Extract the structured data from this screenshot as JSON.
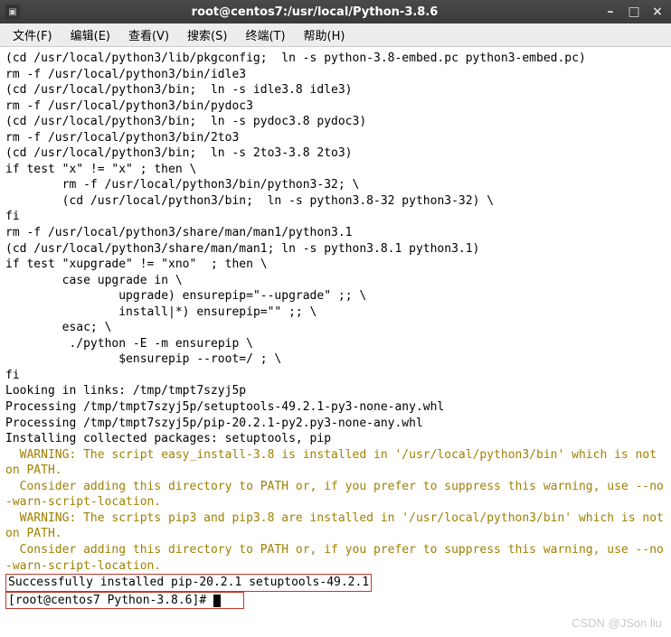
{
  "window": {
    "title": "root@centos7:/usr/local/Python-3.8.6",
    "min": "–",
    "max": "□",
    "close": "×"
  },
  "menu": {
    "file": "文件(F)",
    "edit": "编辑(E)",
    "view": "查看(V)",
    "search": "搜索(S)",
    "terminal": "终端(T)",
    "help": "帮助(H)"
  },
  "terminal": {
    "l1": "(cd /usr/local/python3/lib/pkgconfig;  ln -s python-3.8-embed.pc python3-embed.pc)",
    "l2": "rm -f /usr/local/python3/bin/idle3",
    "l3": "(cd /usr/local/python3/bin;  ln -s idle3.8 idle3)",
    "l4": "rm -f /usr/local/python3/bin/pydoc3",
    "l5": "(cd /usr/local/python3/bin;  ln -s pydoc3.8 pydoc3)",
    "l6": "rm -f /usr/local/python3/bin/2to3",
    "l7": "(cd /usr/local/python3/bin;  ln -s 2to3-3.8 2to3)",
    "l8": "if test \"x\" != \"x\" ; then \\",
    "l9": "        rm -f /usr/local/python3/bin/python3-32; \\",
    "l10": "        (cd /usr/local/python3/bin;  ln -s python3.8-32 python3-32) \\",
    "l11": "fi",
    "l12": "rm -f /usr/local/python3/share/man/man1/python3.1",
    "l13": "(cd /usr/local/python3/share/man/man1; ln -s python3.8.1 python3.1)",
    "l14": "if test \"xupgrade\" != \"xno\"  ; then \\",
    "l15": "        case upgrade in \\",
    "l16": "                upgrade) ensurepip=\"--upgrade\" ;; \\",
    "l17": "                install|*) ensurepip=\"\" ;; \\",
    "l18": "        esac; \\",
    "l19": "         ./python -E -m ensurepip \\",
    "l20": "                $ensurepip --root=/ ; \\",
    "l21": "fi",
    "l22": "Looking in links: /tmp/tmpt7szyj5p",
    "l23": "Processing /tmp/tmpt7szyj5p/setuptools-49.2.1-py3-none-any.whl",
    "l24": "Processing /tmp/tmpt7szyj5p/pip-20.2.1-py2.py3-none-any.whl",
    "l25": "Installing collected packages: setuptools, pip",
    "w1": "  WARNING: The script easy_install-3.8 is installed in '/usr/local/python3/bin' which is not on PATH.",
    "w2": "  Consider adding this directory to PATH or, if you prefer to suppress this warning, use --no-warn-script-location.",
    "w3": "  WARNING: The scripts pip3 and pip3.8 are installed in '/usr/local/python3/bin' which is not on PATH.",
    "w4": "  Consider adding this directory to PATH or, if you prefer to suppress this warning, use --no-warn-script-location.",
    "success": "Successfully installed pip-20.2.1 setuptools-49.2.1",
    "prompt": "[root@centos7 Python-3.8.6]# "
  },
  "watermark": "CSDN @JSon liu"
}
